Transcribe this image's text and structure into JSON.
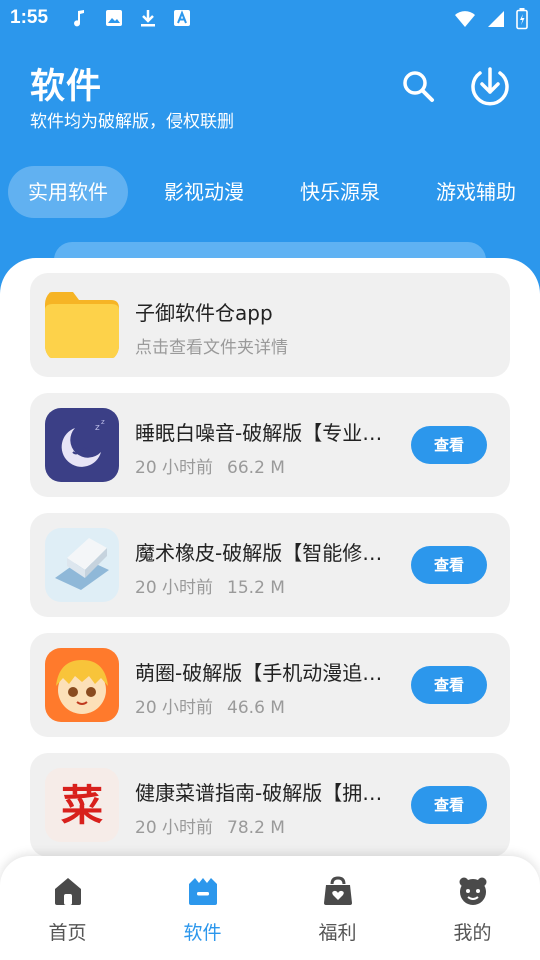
{
  "status_bar": {
    "time": "1:55"
  },
  "header": {
    "title": "软件",
    "subtitle": "软件均为破解版，侵权联删",
    "search_icon": "search-icon",
    "download_icon": "download-icon"
  },
  "tabs": [
    {
      "label": "实用软件",
      "active": true
    },
    {
      "label": "影视动漫",
      "active": false
    },
    {
      "label": "快乐源泉",
      "active": false
    },
    {
      "label": "游戏辅助",
      "active": false
    }
  ],
  "folder": {
    "title": "子御软件仓app",
    "subtitle": "点击查看文件夹详情",
    "icon": "folder-icon"
  },
  "apps": [
    {
      "title": "睡眠白噪音-破解版【专业版】",
      "time": "20 小时前",
      "size": "66.2 M",
      "button": "查看",
      "icon": "moon-icon"
    },
    {
      "title": "魔术橡皮-破解版【智能修图】",
      "time": "20 小时前",
      "size": "15.2 M",
      "button": "查看",
      "icon": "eraser-icon"
    },
    {
      "title": "萌圈-破解版【手机动漫追番】",
      "time": "20 小时前",
      "size": "46.6 M",
      "button": "查看",
      "icon": "anime-face-icon"
    },
    {
      "title": "健康菜谱指南-破解版【拥有会员】",
      "time": "20 小时前",
      "size": "78.2 M",
      "button": "查看",
      "icon": "recipe-icon",
      "icon_text": "菜"
    }
  ],
  "bottom_nav": [
    {
      "label": "首页",
      "icon": "home-icon",
      "active": false
    },
    {
      "label": "软件",
      "icon": "software-icon",
      "active": true
    },
    {
      "label": "福利",
      "icon": "gift-bag-icon",
      "active": false
    },
    {
      "label": "我的",
      "icon": "profile-icon",
      "active": false
    }
  ],
  "colors": {
    "primary": "#2c97ec",
    "card_bg": "#f0f0f0",
    "meta_text": "#9a9a9a"
  }
}
